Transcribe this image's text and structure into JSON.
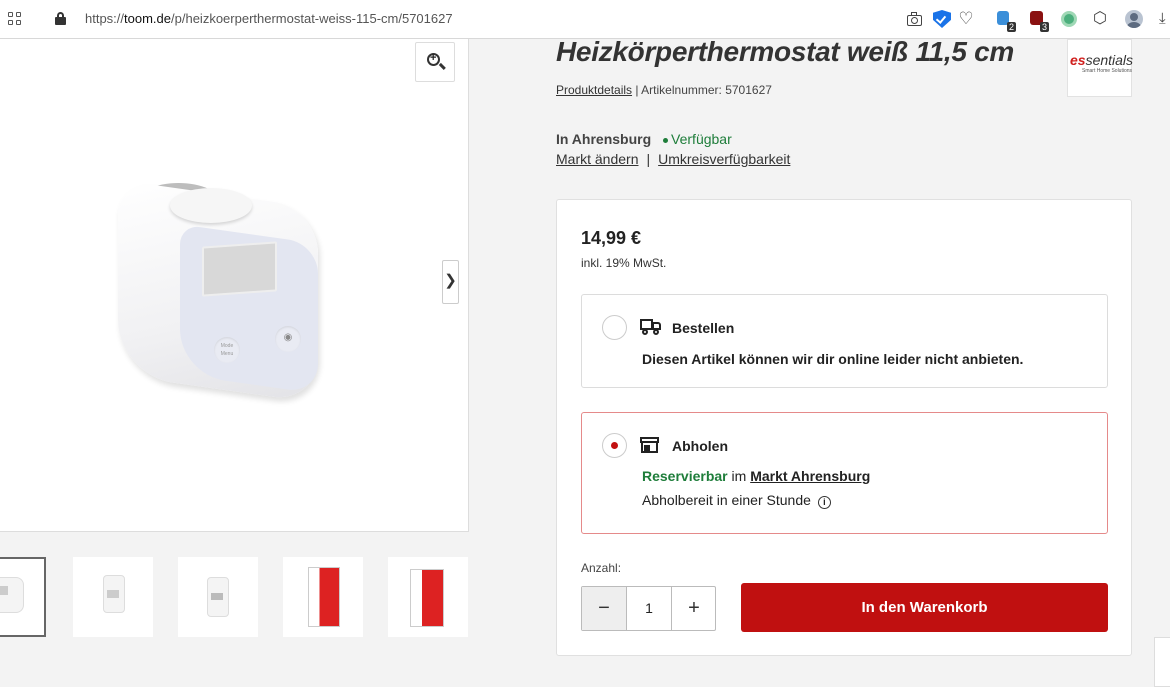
{
  "browser": {
    "url_prefix": "https://",
    "url_host": "toom.de",
    "url_path": "/p/heizkoerperthermostat-weiss-115-cm/5701627",
    "ext_badge_1": "2",
    "ext_badge_2": "3"
  },
  "gallery": {
    "screen_button_label": "Mode Menu"
  },
  "product": {
    "title": "Heizkörperthermostat weiß 11,5 cm",
    "details_link": "Produktdetails",
    "article_number": "| Artikelnummer: 5701627",
    "brand_logo": "sentials",
    "brand_logo_prefix": "es",
    "brand_sub": "Smart Home Solutions"
  },
  "availability": {
    "location": "In Ahrensburg",
    "status": "Verfügbar",
    "change_store": "Markt ändern",
    "separator": "|",
    "radius": "Umkreisverfügbarkeit"
  },
  "buybox": {
    "price": "14,99 €",
    "vat": "inkl. 19% MwSt.",
    "order": {
      "title": "Bestellen",
      "text": "Diesen Artikel können wir dir online leider nicht anbieten."
    },
    "pickup": {
      "title": "Abholen",
      "reservable": "Reservierbar",
      "at": "im",
      "store": "Markt Ahrensburg",
      "ready": "Abholbereit in einer Stunde",
      "info": "i"
    },
    "qty_label": "Anzahl:",
    "qty_minus": "−",
    "qty_value": "1",
    "qty_plus": "+",
    "cart_button": "In den Warenkorb"
  }
}
